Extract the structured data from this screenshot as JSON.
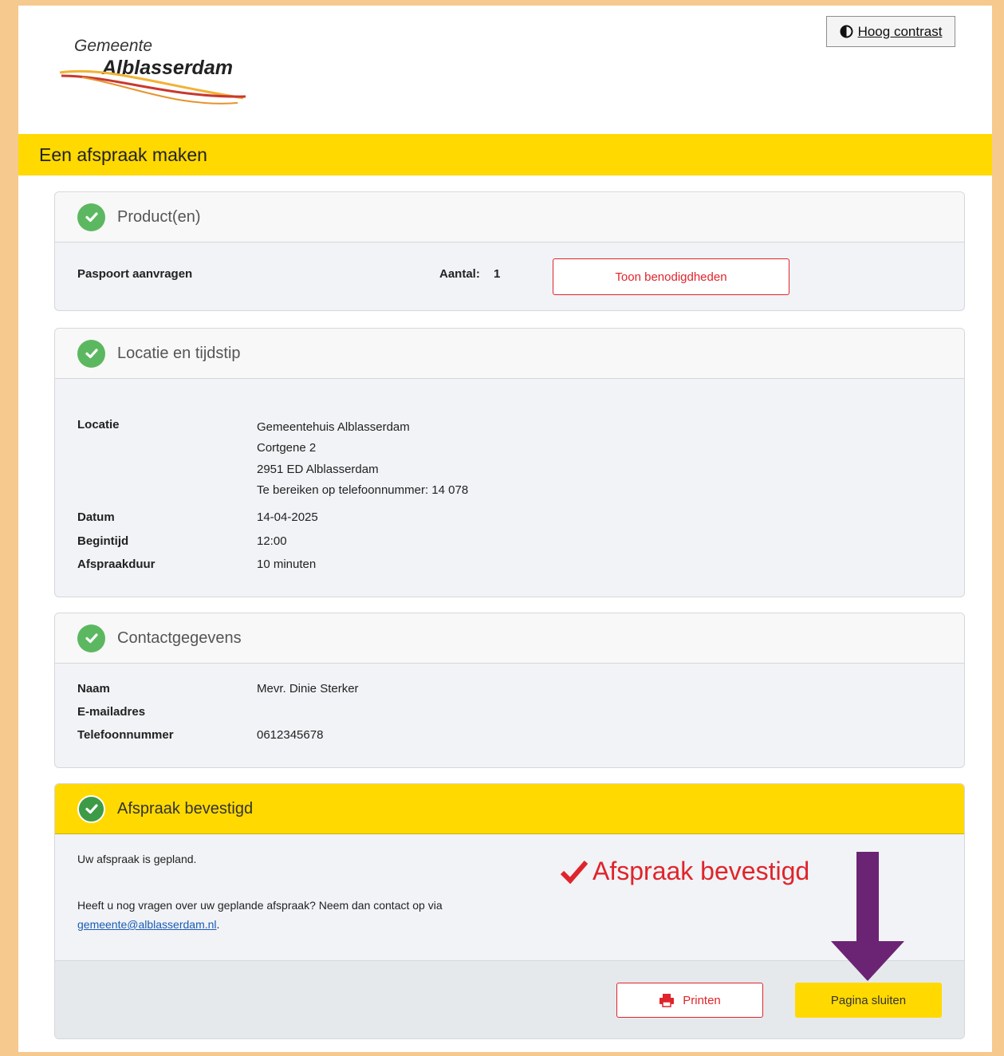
{
  "header": {
    "logo_line1": "Gemeente",
    "logo_line2": "Alblasserdam",
    "contrast_label": "Hoog contrast"
  },
  "banner": {
    "title": "Een afspraak maken"
  },
  "products": {
    "title": "Product(en)",
    "product_name": "Paspoort aanvragen",
    "count_label": "Aantal:",
    "count_value": "1",
    "requirements_button": "Toon benodigdheden"
  },
  "location": {
    "title": "Locatie en tijdstip",
    "location_label": "Locatie",
    "address_lines": [
      "Gemeentehuis Alblasserdam",
      "Cortgene 2",
      "2951 ED Alblasserdam",
      "Te bereiken op telefoonnummer: 14 078"
    ],
    "date_label": "Datum",
    "date_value": "14-04-2025",
    "start_label": "Begintijd",
    "start_value": "12:00",
    "duration_label": "Afspraakduur",
    "duration_value": "10 minuten"
  },
  "contact": {
    "title": "Contactgegevens",
    "name_label": "Naam",
    "name_value": "Mevr. Dinie Sterker",
    "email_label": "E-mailadres",
    "email_value": "",
    "phone_label": "Telefoonnummer",
    "phone_value": "0612345678"
  },
  "confirmation": {
    "title": "Afspraak bevestigd",
    "planned_text": "Uw afspraak is gepland.",
    "questions_text": "Heeft u nog vragen over uw geplande afspraak? Neem dan contact op via",
    "email_link": "gemeente@alblasserdam.nl",
    "after_link": ".",
    "annotation": "Afspraak bevestigd",
    "print_button": "Printen",
    "close_button": "Pagina sluiten"
  },
  "colors": {
    "brand_yellow": "#ffd900",
    "accent_red": "#e0242b",
    "success_green": "#5cb860",
    "arrow_purple": "#6b2473",
    "frame": "#f6c98f"
  }
}
